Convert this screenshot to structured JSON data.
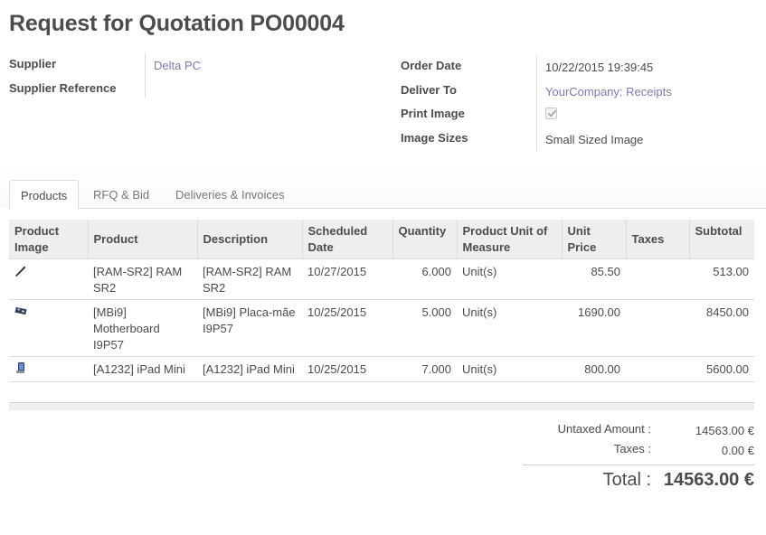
{
  "page": {
    "title": "Request for Quotation PO00004"
  },
  "form": {
    "supplier_label": "Supplier",
    "supplier_value": "Delta PC",
    "supplier_ref_label": "Supplier Reference",
    "supplier_ref_value": "",
    "order_date_label": "Order Date",
    "order_date_value": "10/22/2015 19:39:45",
    "deliver_to_label": "Deliver To",
    "deliver_to_value": "YourCompany: Receipts",
    "print_image_label": "Print Image",
    "print_image_checked": true,
    "image_sizes_label": "Image Sizes",
    "image_sizes_value": "Small Sized Image"
  },
  "tabs": [
    {
      "label": "Products",
      "active": true
    },
    {
      "label": "RFQ & Bid",
      "active": false
    },
    {
      "label": "Deliveries & Invoices",
      "active": false
    }
  ],
  "table": {
    "headers": {
      "image": "Product Image",
      "product": "Product",
      "description": "Description",
      "scheduled": "Scheduled Date",
      "quantity": "Quantity",
      "uom": "Product Unit of Measure",
      "price": "Unit Price",
      "taxes": "Taxes",
      "subtotal": "Subtotal"
    },
    "rows": [
      {
        "icon": "memory-stick-icon",
        "product": "[RAM-SR2] RAM SR2",
        "description": "[RAM-SR2] RAM SR2",
        "scheduled": "10/27/2015",
        "quantity": "6.000",
        "uom": "Unit(s)",
        "price": "85.50",
        "taxes": "",
        "subtotal": "513.00"
      },
      {
        "icon": "motherboard-icon",
        "product": "[MBi9] Motherboard I9P57",
        "description": "[MBi9] Placa-mãe I9P57",
        "scheduled": "10/25/2015",
        "quantity": "5.000",
        "uom": "Unit(s)",
        "price": "1690.00",
        "taxes": "",
        "subtotal": "8450.00"
      },
      {
        "icon": "ipad-icon",
        "product": "[A1232] iPad Mini",
        "description": "[A1232] iPad Mini",
        "scheduled": "10/25/2015",
        "quantity": "7.000",
        "uom": "Unit(s)",
        "price": "800.00",
        "taxes": "",
        "subtotal": "5600.00"
      }
    ]
  },
  "totals": {
    "untaxed_label": "Untaxed Amount :",
    "untaxed_value": "14563.00 €",
    "taxes_label": "Taxes :",
    "taxes_value": "0.00 €",
    "total_label": "Total :",
    "total_value": "14563.00 €"
  },
  "colors": {
    "link": "#7c7bad",
    "text": "#4c4c4c",
    "header_bg": "#eeeeee",
    "border": "#dcdcdc"
  }
}
